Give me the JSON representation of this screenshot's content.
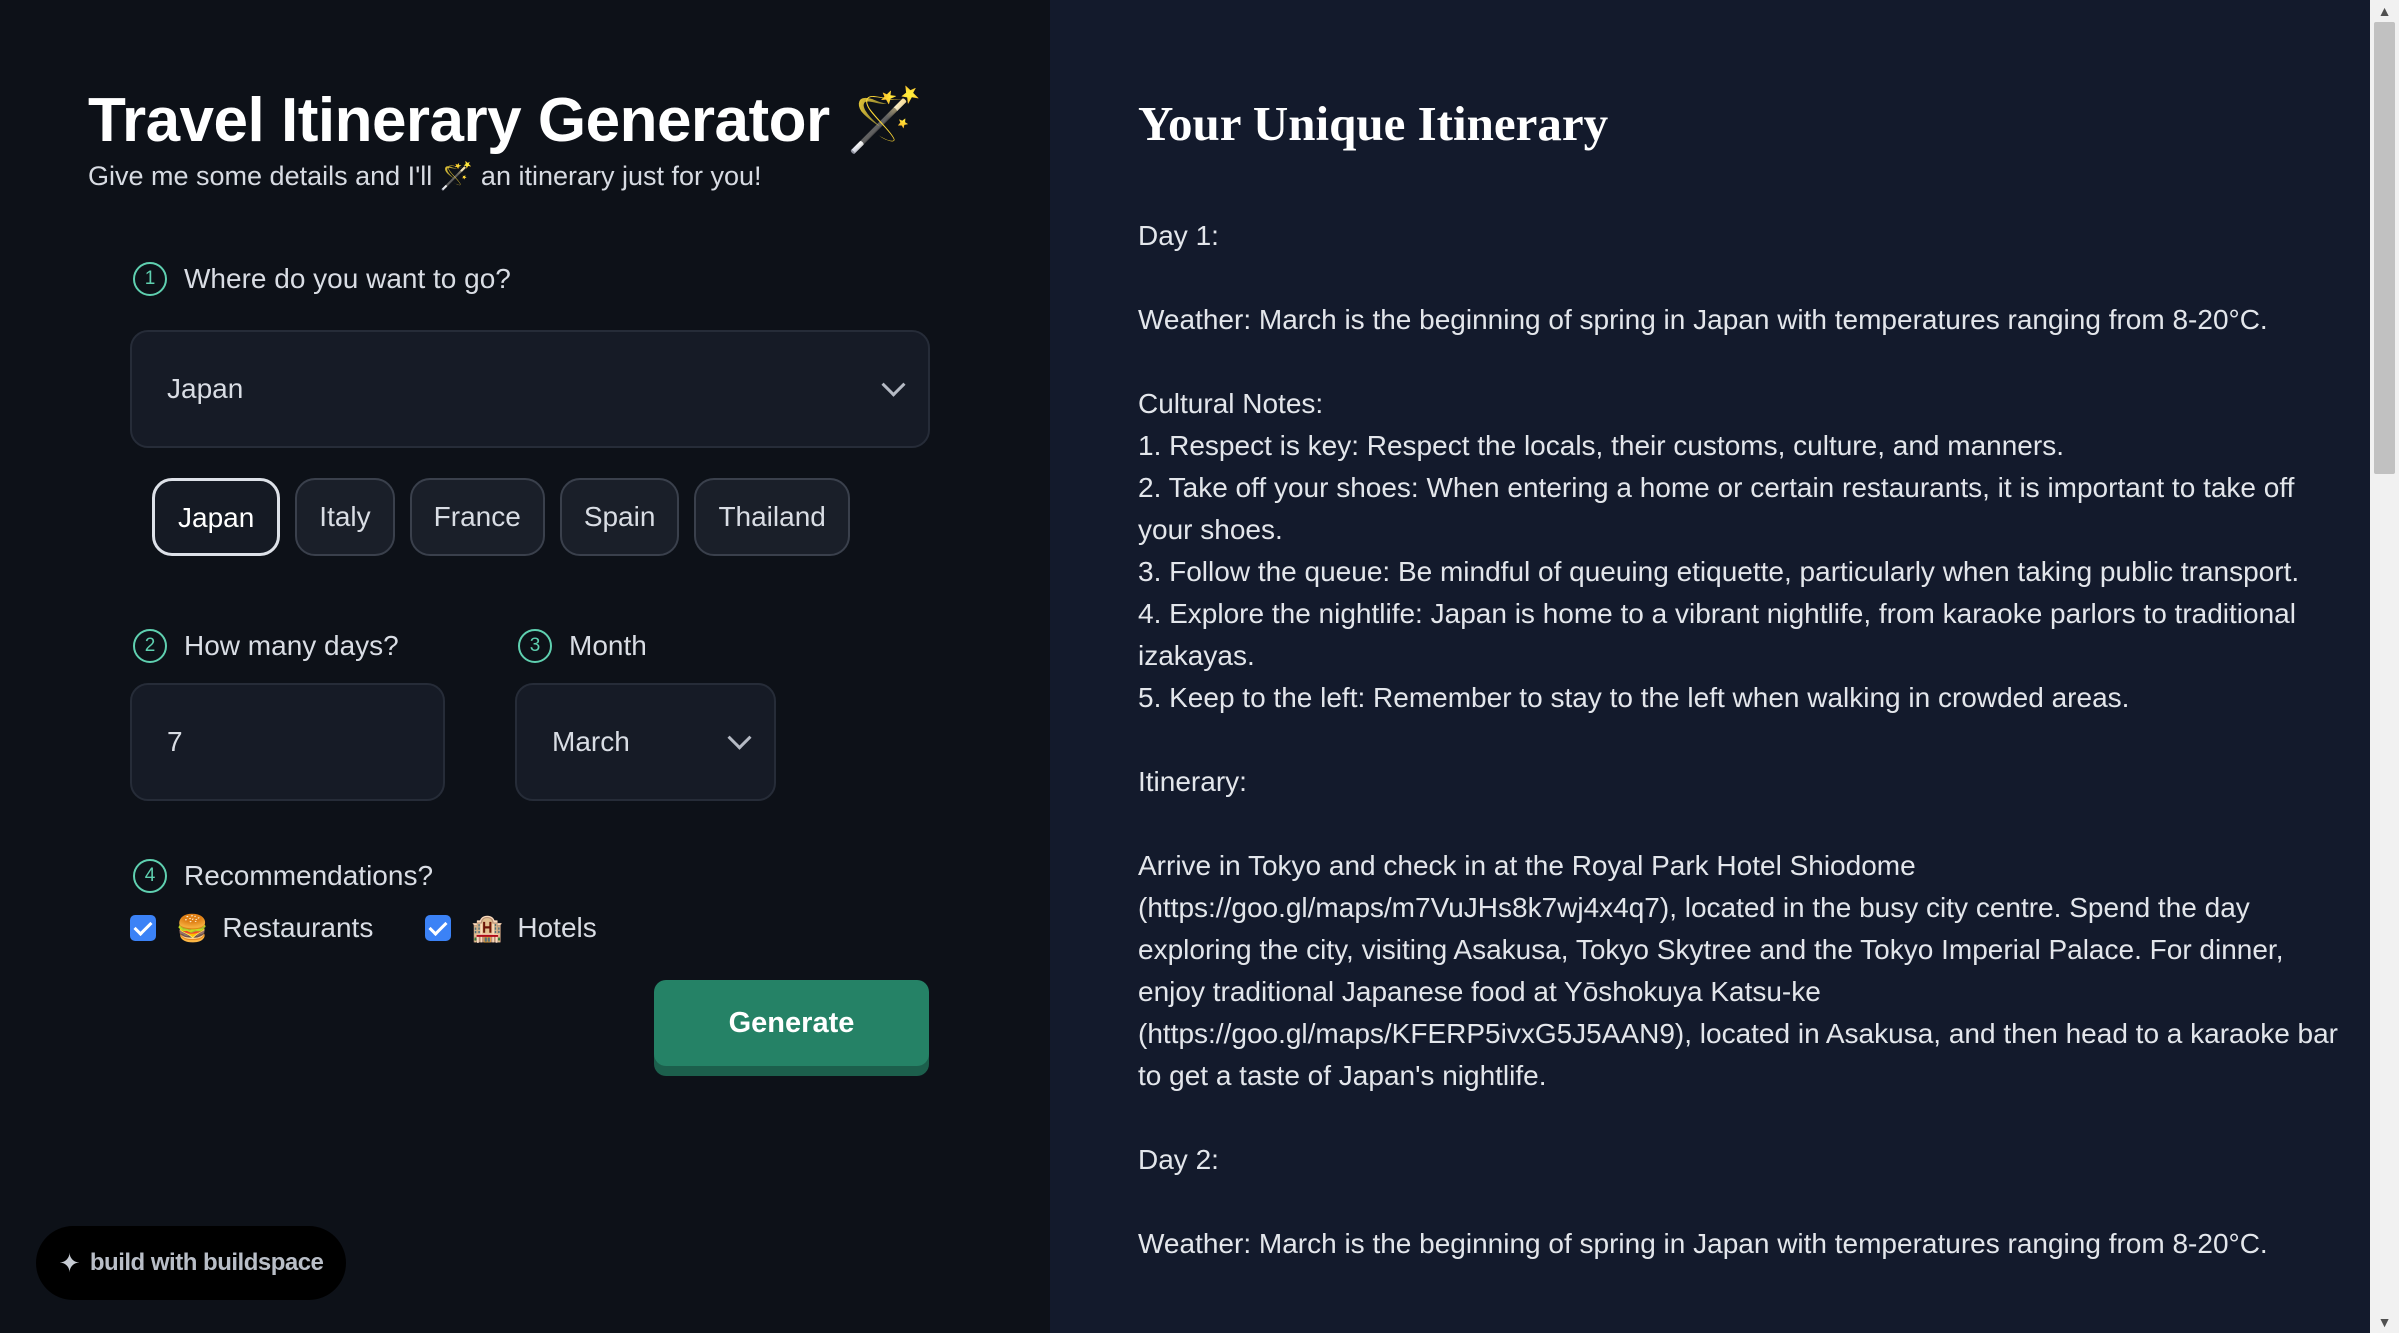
{
  "form": {
    "title": "Travel Itinerary Generator 🪄",
    "subtitle": "Give me some details and I'll 🪄 an itinerary just for you!",
    "destination": {
      "step": "1",
      "label": "Where do you want to go?",
      "selected": "Japan",
      "chips": [
        "Japan",
        "Italy",
        "France",
        "Spain",
        "Thailand"
      ],
      "active_chip": "Japan"
    },
    "days": {
      "step": "2",
      "label": "How many days?",
      "value": "7"
    },
    "month": {
      "step": "3",
      "label": "Month",
      "selected": "March"
    },
    "recommendations": {
      "step": "4",
      "label": "Recommendations?",
      "options": [
        {
          "emoji": "🍔",
          "label": "Restaurants",
          "checked": true
        },
        {
          "emoji": "🏨",
          "label": "Hotels",
          "checked": true
        }
      ]
    },
    "generate_label": "Generate"
  },
  "badge": {
    "label": "build with buildspace"
  },
  "output": {
    "title": "Your Unique Itinerary",
    "text": "Day 1:\n\nWeather: March is the beginning of spring in Japan with temperatures ranging from 8-20°C.\n\nCultural Notes:\n1. Respect is key: Respect the locals, their customs, culture, and manners.\n2. Take off your shoes: When entering a home or certain restaurants, it is important to take off your shoes.\n3. Follow the queue: Be mindful of queuing etiquette, particularly when taking public transport.\n4. Explore the nightlife: Japan is home to a vibrant nightlife, from karaoke parlors to traditional izakayas.\n5. Keep to the left: Remember to stay to the left when walking in crowded areas.\n\nItinerary:\n\nArrive in Tokyo and check in at the Royal Park Hotel Shiodome (https://goo.gl/maps/m7VuJHs8k7wj4x4q7), located in the busy city centre. Spend the day exploring the city, visiting Asakusa, Tokyo Skytree and the Tokyo Imperial Palace. For dinner, enjoy traditional Japanese food at Yōshokuya Katsu-ke (https://goo.gl/maps/KFERP5ivxG5J5AAN9), located in Asakusa, and then head to a karaoke bar to get a taste of Japan's nightlife.\n\nDay 2:\n\nWeather: March is the beginning of spring in Japan with temperatures ranging from 8-20°C."
  },
  "colors": {
    "left_bg": "#0d1118",
    "right_bg": "#131a2c",
    "accent_green": "#258266",
    "step_teal": "#5fd0b0",
    "checkbox_blue": "#3b82f6"
  }
}
